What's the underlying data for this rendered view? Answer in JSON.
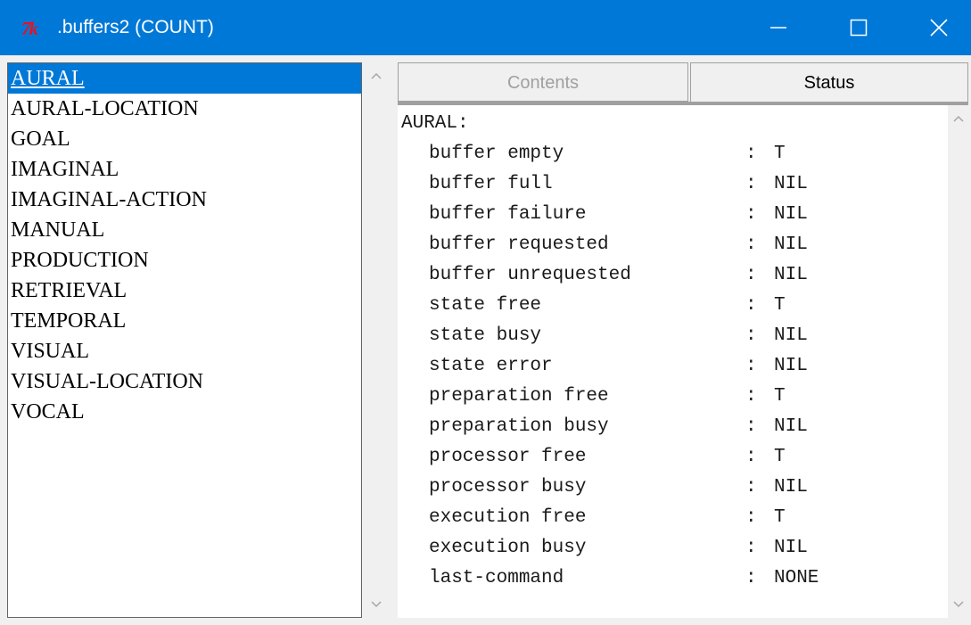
{
  "window": {
    "logo_text": "7k",
    "title": ".buffers2 (COUNT)",
    "accent_color": "#0078d7",
    "logo_color": "#e81123",
    "controls": [
      "minimize-icon",
      "maximize-icon",
      "close-icon"
    ]
  },
  "buffers": {
    "selected": "AURAL",
    "items": [
      "AURAL",
      "AURAL-LOCATION",
      "GOAL",
      "IMAGINAL",
      "IMAGINAL-ACTION",
      "MANUAL",
      "PRODUCTION",
      "RETRIEVAL",
      "TEMPORAL",
      "VISUAL",
      "VISUAL-LOCATION",
      "VOCAL"
    ]
  },
  "tabs": {
    "contents": "Contents",
    "status": "Status",
    "active": "Status"
  },
  "status": {
    "header": "AURAL:",
    "separator": ":",
    "rows": [
      {
        "key": "buffer empty",
        "value": "T"
      },
      {
        "key": "buffer full",
        "value": "NIL"
      },
      {
        "key": "buffer failure",
        "value": "NIL"
      },
      {
        "key": "buffer requested",
        "value": "NIL"
      },
      {
        "key": "buffer unrequested",
        "value": "NIL"
      },
      {
        "key": "state free",
        "value": "T"
      },
      {
        "key": "state busy",
        "value": "NIL"
      },
      {
        "key": "state error",
        "value": "NIL"
      },
      {
        "key": "preparation free",
        "value": "T"
      },
      {
        "key": "preparation busy",
        "value": "NIL"
      },
      {
        "key": "processor free",
        "value": "T"
      },
      {
        "key": "processor busy",
        "value": "NIL"
      },
      {
        "key": "execution free",
        "value": "T"
      },
      {
        "key": "execution busy",
        "value": "NIL"
      },
      {
        "key": "last-command",
        "value": "NONE"
      }
    ]
  }
}
